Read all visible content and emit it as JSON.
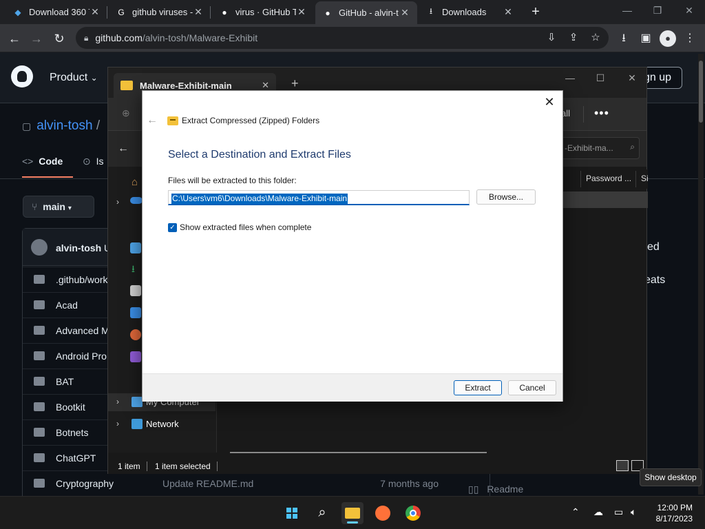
{
  "browser": {
    "tabs": [
      {
        "title": "Download 360 T",
        "icon": "360-icon"
      },
      {
        "title": "github viruses -",
        "icon": "google-icon"
      },
      {
        "title": "virus · GitHub To",
        "icon": "github-icon"
      },
      {
        "title": "GitHub - alvin-t",
        "icon": "github-icon"
      },
      {
        "title": "Downloads",
        "icon": "download-icon"
      }
    ],
    "url_host": "github.com",
    "url_path": "/alvin-tosh/Malware-Exhibit"
  },
  "github": {
    "nav_product": "Product",
    "sign_up": "gn up",
    "repo_owner": "alvin-tosh",
    "repo_sep": "/",
    "tab_code": "Code",
    "tab_issues": "Is",
    "branch": "main",
    "commit_user": "alvin-tosh",
    "commit_user_suffix": "U",
    "files": [
      {
        "name": ".github/workf",
        "message": "",
        "age": ""
      },
      {
        "name": "Acad",
        "message": "",
        "age": ""
      },
      {
        "name": "Advanced M",
        "message": "",
        "age": ""
      },
      {
        "name": "Android Pro",
        "message": "",
        "age": ""
      },
      {
        "name": "BAT",
        "message": "",
        "age": ""
      },
      {
        "name": "Bootkit",
        "message": "",
        "age": ""
      },
      {
        "name": "Botnets",
        "message": "",
        "age": ""
      },
      {
        "name": "ChatGPT",
        "message": "",
        "age": ""
      },
      {
        "name": "Cryptography",
        "message": "Update README.md",
        "age": "7 months ago"
      }
    ],
    "side_text_1": "ed",
    "side_text_2": "eats",
    "readme": "Readme"
  },
  "explorer": {
    "tab_title": "Malware-Exhibit-main",
    "cmd_all": "all",
    "search_placeholder": "-Exhibit-ma...",
    "col_password": "Password ...",
    "col_size": "Si",
    "nav_my_computer": "My Computer",
    "nav_network": "Network",
    "status_items": "1 item",
    "status_selected": "1 item selected"
  },
  "dialog": {
    "header": "Extract Compressed (Zipped) Folders",
    "title": "Select a Destination and Extract Files",
    "label": "Files will be extracted to this folder:",
    "path": "C:\\Users\\vm6\\Downloads\\Malware-Exhibit-main",
    "browse": "Browse...",
    "checkbox_label": "Show extracted files when complete",
    "checkbox_checked": true,
    "extract": "Extract",
    "cancel": "Cancel"
  },
  "taskbar": {
    "time": "12:00 PM",
    "date": "8/17/2023",
    "tooltip": "Show desktop"
  }
}
